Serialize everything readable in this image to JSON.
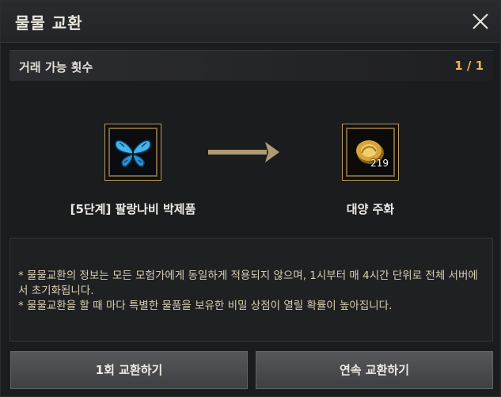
{
  "title": "물물 교환",
  "trade": {
    "label": "거래 가능 횟수",
    "count": "1 / 1"
  },
  "exchange": {
    "give": {
      "name": "[5단계] 팔랑나비 박제품",
      "icon": "butterfly-icon"
    },
    "receive": {
      "name": "대양 주화",
      "quantity": "219",
      "icon": "gold-coin-icon"
    }
  },
  "notes": [
    "* 물물교환의 정보는 모든 모험가에게 동일하게 적용되지 않으며, 1시부터 매 4시간 단위로 전체 서버에서 초기화됩니다.",
    "* 물물교환을 할 때 마다 특별한 물품을 보유한 비밀 상점이 열릴 확률이 높아집니다."
  ],
  "buttons": {
    "once": "1회 교환하기",
    "continuous": "연속 교환하기"
  },
  "colors": {
    "accent": "#e9b84a",
    "slot_border": "#b99a63",
    "note_text": "#d9cfb3"
  }
}
